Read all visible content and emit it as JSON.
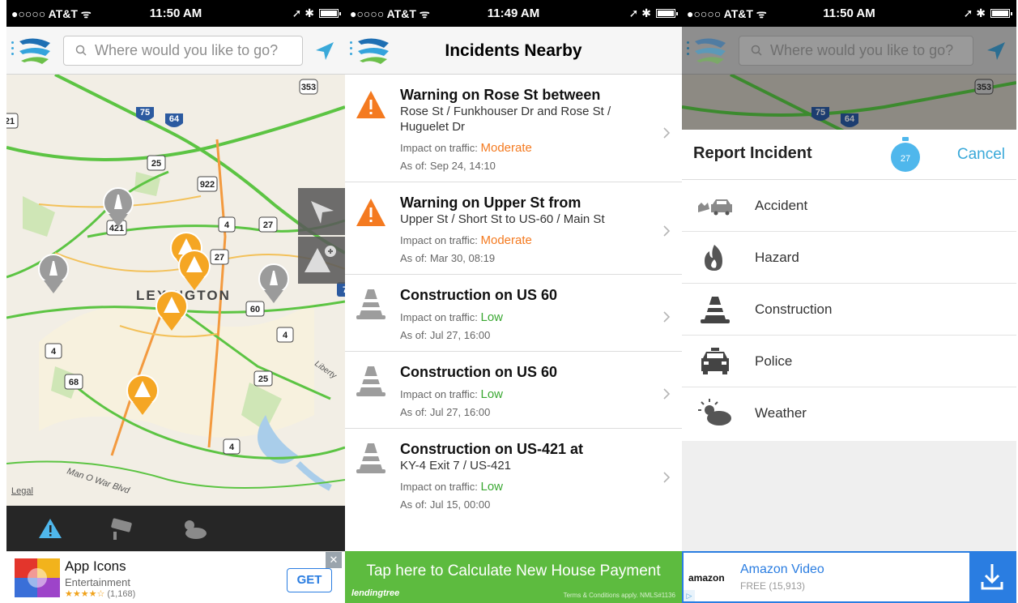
{
  "status": {
    "left": {
      "carrier": "●○○○○ AT&T ᯤ",
      "time": "11:50 AM",
      "right": "➚ ✱"
    },
    "middle": {
      "carrier": "●○○○○ AT&T ᯤ",
      "time": "11:49 AM",
      "right": "➚ ✱"
    },
    "right": {
      "carrier": "●○○○○ AT&T ᯤ",
      "time": "11:50 AM",
      "right": "➚ ✱"
    }
  },
  "search": {
    "placeholder": "Where would you like to go?"
  },
  "map": {
    "legal": "Legal",
    "city_label": "LEXINGTON",
    "road_labels": [
      "Man O War Blvd",
      "Liberty"
    ],
    "shields": [
      "353",
      "75",
      "64",
      "21",
      "25",
      "922",
      "4",
      "27",
      "421",
      "27",
      "60",
      "4",
      "4",
      "68",
      "25",
      "4",
      "7"
    ]
  },
  "incidents_screen": {
    "title": "Incidents Nearby",
    "impact_label": "Impact on traffic:",
    "items": [
      {
        "type": "warning",
        "title": "Warning on Rose St between",
        "detail": "Rose St / Funkhouser Dr and Rose St / Huguelet Dr",
        "impact": "Moderate",
        "asof": "As of: Sep 24, 14:10"
      },
      {
        "type": "warning",
        "title": "Warning on Upper St from",
        "detail": "Upper St / Short St to US-60 / Main St",
        "impact": "Moderate",
        "asof": "As of: Mar 30, 08:19"
      },
      {
        "type": "construction",
        "title": "Construction on US 60",
        "detail": "",
        "impact": "Low",
        "asof": "As of: Jul 27, 16:00"
      },
      {
        "type": "construction",
        "title": "Construction on US 60",
        "detail": "",
        "impact": "Low",
        "asof": "As of: Jul 27, 16:00"
      },
      {
        "type": "construction",
        "title": "Construction on US-421 at",
        "detail": "KY-4 Exit 7 / US-421",
        "impact": "Low",
        "asof": "As of: Jul 15, 00:00"
      }
    ]
  },
  "report": {
    "title": "Report Incident",
    "timer": "27",
    "cancel": "Cancel",
    "options": [
      "Accident",
      "Hazard",
      "Construction",
      "Police",
      "Weather"
    ]
  },
  "ads": {
    "app": {
      "title": "App Icons",
      "category": "Entertainment",
      "stars": "★★★★☆",
      "ratings": "(1,168)",
      "cta": "GET",
      "close": "✕"
    },
    "lending": {
      "headline": "Tap here to Calculate New House Payment",
      "brand": "lendingtree",
      "terms": "Terms & Conditions apply. NMLS#1136"
    },
    "amazon": {
      "brand": "amazon",
      "title": "Amazon Video",
      "price": "FREE",
      "ratings": "(15,913)",
      "badge": "▷"
    }
  },
  "colors": {
    "moderate": "#f47a20",
    "low": "#3aa832",
    "accent": "#3aa9d9",
    "pin_orange": "#f5a623",
    "pin_grey": "#9b9b9b"
  }
}
